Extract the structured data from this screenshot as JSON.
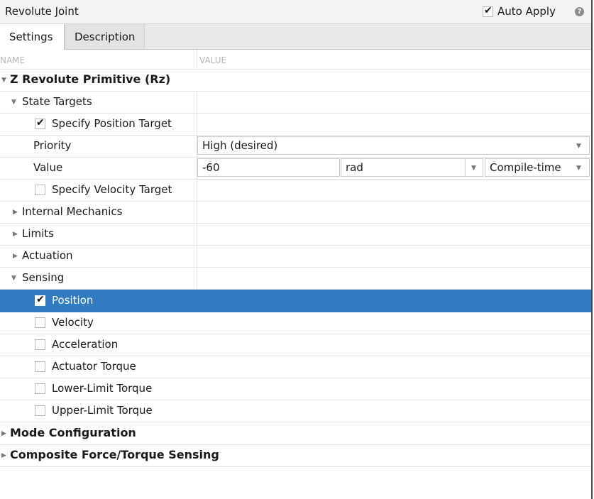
{
  "window": {
    "title": "Revolute Joint",
    "auto_apply_label": "Auto Apply",
    "auto_apply_checked": true
  },
  "tabs": [
    {
      "label": "Settings"
    },
    {
      "label": "Description"
    }
  ],
  "columns": {
    "name": "NAME",
    "value": "VALUE"
  },
  "tree": {
    "primitive": "Z Revolute Primitive (Rz)",
    "state_targets": "State Targets",
    "specify_position": "Specify Position Target",
    "priority_label": "Priority",
    "priority_value": "High (desired)",
    "value_label": "Value",
    "value_number": "-60",
    "value_unit": "rad",
    "value_compile": "Compile-time",
    "specify_velocity": "Specify Velocity Target",
    "internal_mechanics": "Internal Mechanics",
    "limits": "Limits",
    "actuation": "Actuation",
    "sensing": "Sensing",
    "sensing_items": [
      "Position",
      "Velocity",
      "Acceleration",
      "Actuator Torque",
      "Lower-Limit Torque",
      "Upper-Limit Torque"
    ],
    "mode_configuration": "Mode Configuration",
    "composite_sensing": "Composite Force/Torque Sensing"
  },
  "colors": {
    "selection": "#2f7bbd"
  }
}
